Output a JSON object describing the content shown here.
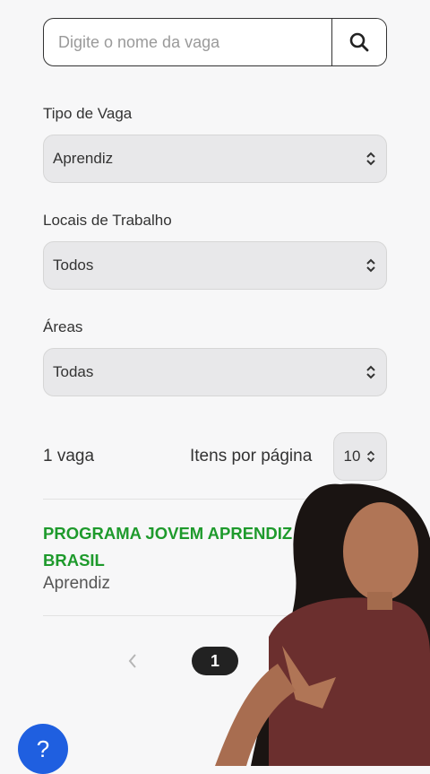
{
  "search": {
    "placeholder": "Digite o nome da vaga",
    "icon": "search-icon"
  },
  "filters": [
    {
      "label": "Tipo de Vaga",
      "value": "Aprendiz"
    },
    {
      "label": "Locais de Trabalho",
      "value": "Todos"
    },
    {
      "label": "Áreas",
      "value": "Todas"
    }
  ],
  "results": {
    "count_text": "1 vaga",
    "per_page_label": "Itens por página",
    "per_page_value": "10"
  },
  "job": {
    "title": "PROGRAMA JOVEM APRENDIZ | EM TODO BRASIL",
    "type": "Aprendiz"
  },
  "pagination": {
    "current_page": "1"
  },
  "help": {
    "label": "?"
  },
  "colors": {
    "accent_green": "#1e9a2c",
    "help_blue": "#1f5fe0",
    "page_active": "#222222"
  }
}
